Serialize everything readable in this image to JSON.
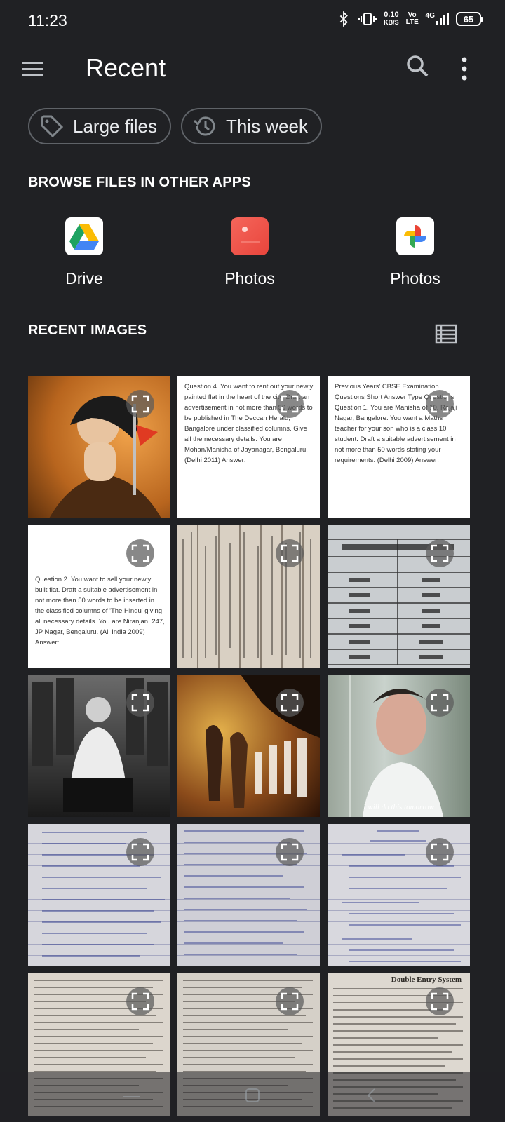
{
  "status": {
    "time": "11:23",
    "speed_value": "0.10",
    "speed_unit": "KB/S",
    "volte": "Vo LTE",
    "network": "4G",
    "battery": "65"
  },
  "app_bar": {
    "title": "Recent",
    "menu_icon": "menu-icon",
    "search_icon": "search-icon",
    "more_icon": "more-vert-icon"
  },
  "chips": [
    {
      "label": "Large files",
      "icon": "tag-icon"
    },
    {
      "label": "This week",
      "icon": "history-icon"
    }
  ],
  "browse": {
    "header": "BROWSE FILES IN OTHER APPS",
    "apps": [
      {
        "label": "Drive",
        "icon": "google-drive-icon"
      },
      {
        "label": "Photos",
        "icon": "photos-app-icon"
      },
      {
        "label": "Photos",
        "icon": "google-photos-icon"
      }
    ]
  },
  "recent": {
    "header": "RECENT IMAGES",
    "view_icon": "list-view-icon",
    "thumbs": [
      {
        "text": ""
      },
      {
        "text": "Question 4. You want to rent out your newly painted flat in the heart of the city. Draft an advertisement in not more than 50 words to be published in The Deccan Herald, Bangalore under classified columns. Give all the necessary details. You are Mohan/Manisha of Jayanagar, Bengaluru. (Delhi 2011) Answer:"
      },
      {
        "text": "Previous Years' CBSE Examination Questions  Short Answer Type Questions  Question 1. You are Manisha of 10, Rajaji Nagar, Bangalore. You want a Maths teacher for your son who is a class 10 student. Draft a suitable advertisement in not more than 50 words stating your requirements. (Delhi 2009) Answer:"
      },
      {
        "text": "Question 2. You want to sell your newly built flat. Draft a suitable advertisement in not more than 50 words to be inserted in the classified columns of 'The Hindu' giving all necessary details. You are Niranjan, 247, JP Nagar, Bengaluru. (All India 2009) Answer:"
      },
      {
        "text": ""
      },
      {
        "text": ""
      },
      {
        "text": ""
      },
      {
        "text": ""
      },
      {
        "text": "I will do this tomorrow"
      },
      {
        "text": ""
      },
      {
        "text": ""
      },
      {
        "text": ""
      },
      {
        "text": ""
      },
      {
        "text": ""
      },
      {
        "text": "Double Entry System"
      }
    ]
  }
}
